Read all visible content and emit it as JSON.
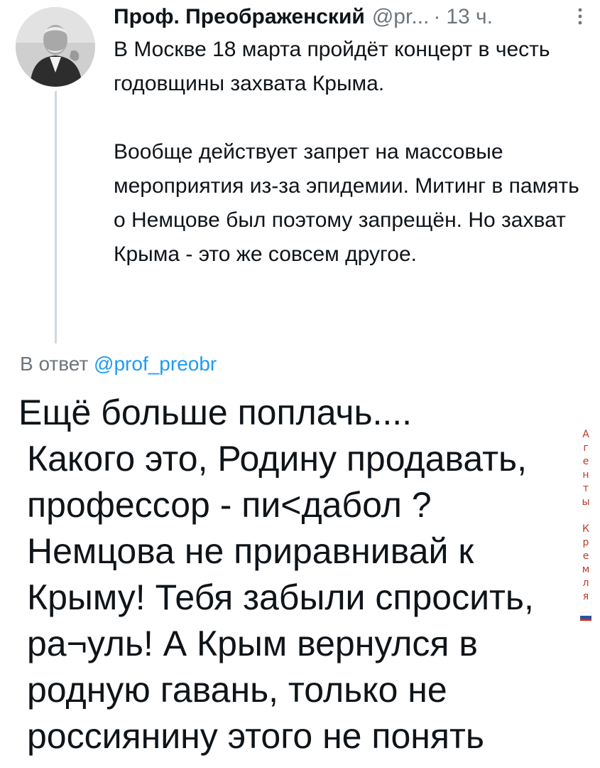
{
  "tweet": {
    "author_name": "Проф. Преображенский",
    "author_handle": "@pr...",
    "separator": "·",
    "time": "13 ч.",
    "paragraphs": [
      "В Москве 18 марта пройдёт концерт в честь годовщины захвата Крыма.",
      "Вообще действует запрет на массовые мероприятия из-за эпидемии. Митинг в память о Немцове был поэтому запрещён. Но захват Крыма - это же совсем другое."
    ]
  },
  "reply": {
    "prefix": "В ответ",
    "mention": "@prof_preobr",
    "lines": [
      "Ещё больше поплачь....",
      "Какого это, Родину продавать, профессор - пи<дабол ? Немцова не приравнивай к Крыму! Тебя забыли спросить, ра¬уль! А Крым вернулся в родную гавань, только не россиянину этого не понять"
    ]
  },
  "watermark": {
    "word1": [
      "А",
      "г",
      "е",
      "н",
      "т",
      "ы"
    ],
    "word2": [
      "К",
      "р",
      "е",
      "м",
      "л",
      "я"
    ],
    "color": "#c0392b",
    "flag_colors": [
      "#ffffff",
      "#1c57a5",
      "#d52b1e"
    ]
  },
  "colors": {
    "text": "#0f1419",
    "muted": "#6e767d",
    "link": "#1d9bf0",
    "thread_line": "#cfd9de"
  },
  "icons": {
    "more": "more-vertical-icon",
    "avatar": "user-avatar"
  }
}
